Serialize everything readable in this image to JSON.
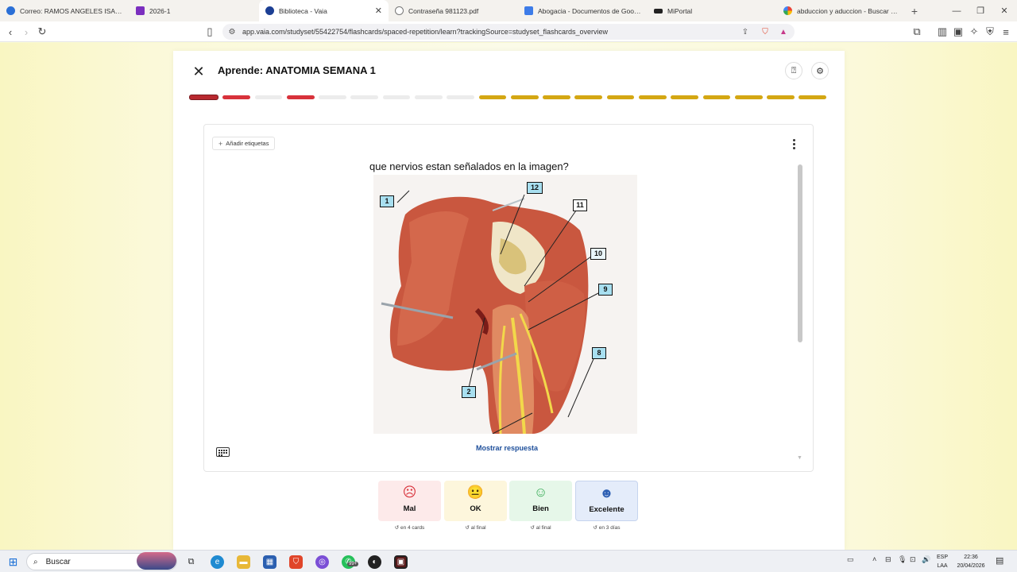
{
  "browser": {
    "tabs": [
      {
        "label": "Correo: RAMOS ANGELES ISABEL CH",
        "color": "#2a6fd6",
        "active": false
      },
      {
        "label": "2026-1",
        "color": "#7b2fbf",
        "active": false
      },
      {
        "label": "Biblioteca - Vaia",
        "color": "#1c3f94",
        "active": true
      },
      {
        "label": "Contraseña 981123.pdf",
        "color": "#777777",
        "active": false
      },
      {
        "label": "Abogacia - Documentos de Google",
        "color": "#3d7ce8",
        "active": false
      },
      {
        "label": "MiPortal",
        "color": "#222222",
        "active": false
      },
      {
        "label": "abduccion y aduccion - Buscar con G",
        "color": "#e0e0e0",
        "active": false
      }
    ],
    "url": "app.vaia.com/studyset/55422754/flashcards/spaced-repetition/learn?trackingSource=studyset_flashcards_overview"
  },
  "header": {
    "title": "Aprende: ANATOMIA SEMANA 1"
  },
  "progress": {
    "segments": [
      "first",
      "wrong",
      "empty",
      "wrong",
      "empty",
      "empty",
      "empty",
      "empty",
      "empty",
      "done",
      "done",
      "done",
      "done",
      "done",
      "done",
      "done",
      "done",
      "done",
      "done",
      "done"
    ]
  },
  "card": {
    "add_tags_label": "Añadir etiquetas",
    "question": "que nervios estan señalados en la imagen?",
    "show_answer_label": "Mostrar respuesta",
    "image_labels": [
      "1",
      "12",
      "11",
      "10",
      "9",
      "8",
      "2"
    ]
  },
  "ratings": [
    {
      "label": "Mal",
      "note": "en 4 cards",
      "bg": "#fdeaea",
      "face_color": "#d8323b"
    },
    {
      "label": "OK",
      "note": "al final",
      "bg": "#fdf6dc",
      "face_color": "#d4a713"
    },
    {
      "label": "Bien",
      "note": "al final",
      "bg": "#e6f7e9",
      "face_color": "#2fa84f"
    },
    {
      "label": "Excelente",
      "note": "en 3 días",
      "bg": "#e4ecfa",
      "face_color": "#2d5fb3"
    }
  ],
  "taskbar": {
    "search_placeholder": "Buscar",
    "lang_line1": "ESP",
    "lang_line2": "LAA",
    "time": "22:36",
    "date": "20/04/2026",
    "whatsapp_badge": "99+"
  }
}
